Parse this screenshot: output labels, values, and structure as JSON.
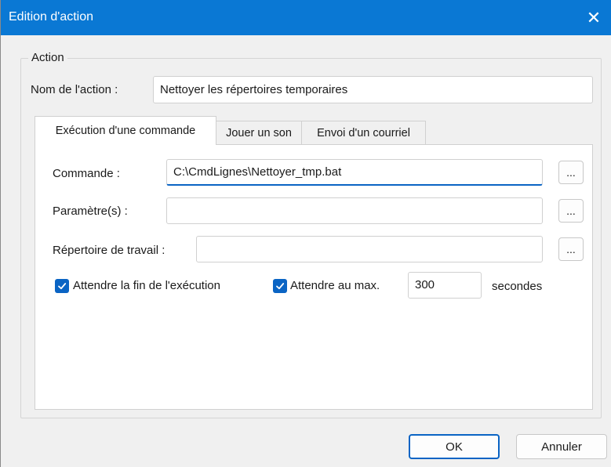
{
  "window": {
    "title": "Edition d'action",
    "close_glyph": "✕",
    "titlebar_color": "#0a78d4"
  },
  "action_group": {
    "legend": "Action",
    "name_label": "Nom de l'action :",
    "name_value": "Nettoyer les répertoires temporaires"
  },
  "tabs": [
    {
      "label": "Exécution d'une commande",
      "active": true
    },
    {
      "label": "Jouer un son",
      "active": false
    },
    {
      "label": "Envoi d'un courriel",
      "active": false
    }
  ],
  "command_tab": {
    "command_label": "Commande :",
    "command_value": "C:\\CmdLignes\\Nettoyer_tmp.bat",
    "params_label": "Paramètre(s) :",
    "params_value": "",
    "workdir_label": "Répertoire de travail :",
    "workdir_value": "",
    "browse_label": "...",
    "wait_end_label": "Attendre la fin de l'exécution",
    "wait_end_checked": true,
    "wait_max_label": "Attendre au max.",
    "wait_max_checked": true,
    "wait_max_value": "300",
    "seconds_label": "secondes"
  },
  "buttons": {
    "ok": "OK",
    "cancel": "Annuler"
  },
  "colors": {
    "accent": "#0a64c4",
    "dialog_bg": "#f0f0f0"
  }
}
